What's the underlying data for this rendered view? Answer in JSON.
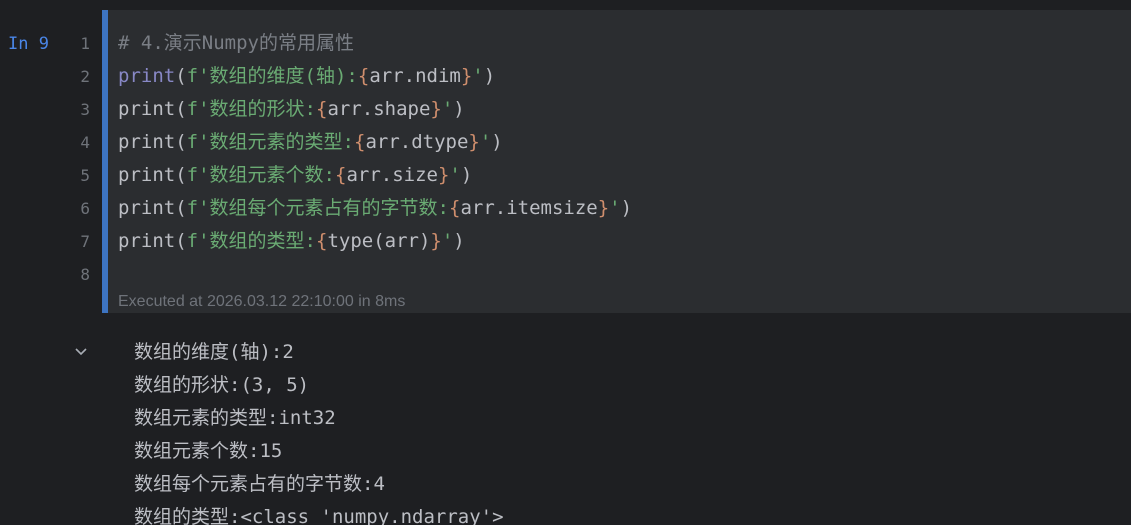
{
  "cell": {
    "prompt": "In 9",
    "line_numbers": [
      "1",
      "2",
      "3",
      "4",
      "5",
      "6",
      "7",
      "8"
    ],
    "lines": [
      [
        {
          "t": "# 4.演示Numpy的常用属性",
          "c": "comment"
        }
      ],
      [
        {
          "t": "print",
          "c": "builtin"
        },
        {
          "t": "(",
          "c": "paren"
        },
        {
          "t": "f'数组的维度(轴):",
          "c": "string"
        },
        {
          "t": "{",
          "c": "brace"
        },
        {
          "t": "arr.ndim",
          "c": "expr"
        },
        {
          "t": "}",
          "c": "brace"
        },
        {
          "t": "'",
          "c": "string"
        },
        {
          "t": ")",
          "c": "paren"
        }
      ],
      [
        {
          "t": "print",
          "c": "expr"
        },
        {
          "t": "(",
          "c": "paren"
        },
        {
          "t": "f'数组的形状:",
          "c": "string"
        },
        {
          "t": "{",
          "c": "brace"
        },
        {
          "t": "arr.shape",
          "c": "expr"
        },
        {
          "t": "}",
          "c": "brace"
        },
        {
          "t": "'",
          "c": "string"
        },
        {
          "t": ")",
          "c": "paren"
        }
      ],
      [
        {
          "t": "print",
          "c": "expr"
        },
        {
          "t": "(",
          "c": "paren"
        },
        {
          "t": "f'数组元素的类型:",
          "c": "string"
        },
        {
          "t": "{",
          "c": "brace"
        },
        {
          "t": "arr.dtype",
          "c": "expr"
        },
        {
          "t": "}",
          "c": "brace"
        },
        {
          "t": "'",
          "c": "string"
        },
        {
          "t": ")",
          "c": "paren"
        }
      ],
      [
        {
          "t": "print",
          "c": "expr"
        },
        {
          "t": "(",
          "c": "paren"
        },
        {
          "t": "f'数组元素个数:",
          "c": "string"
        },
        {
          "t": "{",
          "c": "brace"
        },
        {
          "t": "arr.size",
          "c": "expr"
        },
        {
          "t": "}",
          "c": "brace"
        },
        {
          "t": "'",
          "c": "string"
        },
        {
          "t": ")",
          "c": "paren"
        }
      ],
      [
        {
          "t": "print",
          "c": "expr"
        },
        {
          "t": "(",
          "c": "paren"
        },
        {
          "t": "f'数组每个元素占有的字节数:",
          "c": "string"
        },
        {
          "t": "{",
          "c": "brace"
        },
        {
          "t": "arr.itemsize",
          "c": "expr"
        },
        {
          "t": "}",
          "c": "brace"
        },
        {
          "t": "'",
          "c": "string"
        },
        {
          "t": ")",
          "c": "paren"
        }
      ],
      [
        {
          "t": "print",
          "c": "expr"
        },
        {
          "t": "(",
          "c": "paren"
        },
        {
          "t": "f'数组的类型:",
          "c": "string"
        },
        {
          "t": "{",
          "c": "brace"
        },
        {
          "t": "type(arr)",
          "c": "expr"
        },
        {
          "t": "}",
          "c": "brace"
        },
        {
          "t": "'",
          "c": "string"
        },
        {
          "t": ")",
          "c": "paren"
        }
      ],
      []
    ],
    "exec_info": "Executed at 2026.03.12 22:10:00 in 8ms"
  },
  "output": {
    "toggle_icon": "chevron-down-icon",
    "lines": [
      "数组的维度(轴):2",
      "数组的形状:(3, 5)",
      "数组元素的类型:int32",
      "数组元素个数:15",
      "数组每个元素占有的字节数:4",
      "数组的类型:<class 'numpy.ndarray'>"
    ]
  },
  "colors": {
    "background": "#1e1f22",
    "cell_background": "#2b2d30",
    "cell_accent": "#3d74c2",
    "prompt": "#4a86e8",
    "line_number": "#6f737a",
    "comment": "#7a7e85",
    "builtin": "#8888c6",
    "string": "#6aab73",
    "brace": "#cf8e6d",
    "text": "#bcbec4"
  }
}
